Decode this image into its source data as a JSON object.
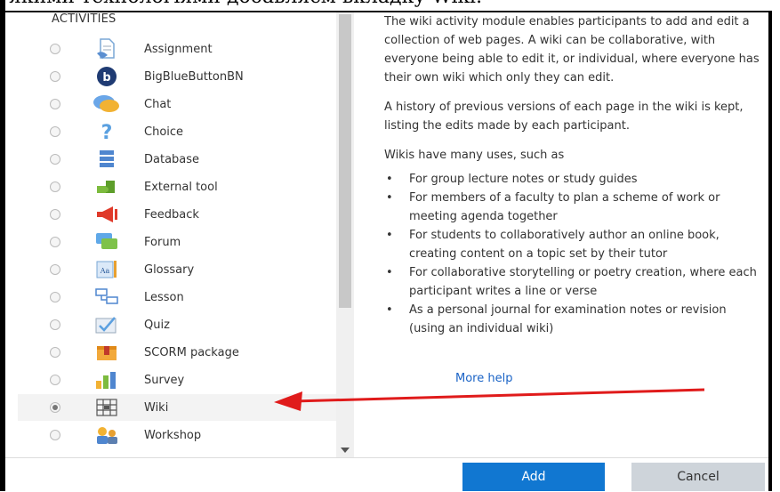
{
  "caption": "якими технологіями добавляєм вкладку Wiki:",
  "list": {
    "header": "ACTIVITIES",
    "items": [
      {
        "label": "Assignment",
        "icon": "assignment-icon",
        "selected": false
      },
      {
        "label": "BigBlueButtonBN",
        "icon": "bigbluebutton-icon",
        "selected": false
      },
      {
        "label": "Chat",
        "icon": "chat-icon",
        "selected": false
      },
      {
        "label": "Choice",
        "icon": "choice-icon",
        "selected": false
      },
      {
        "label": "Database",
        "icon": "database-icon",
        "selected": false
      },
      {
        "label": "External tool",
        "icon": "external-tool-icon",
        "selected": false
      },
      {
        "label": "Feedback",
        "icon": "feedback-icon",
        "selected": false
      },
      {
        "label": "Forum",
        "icon": "forum-icon",
        "selected": false
      },
      {
        "label": "Glossary",
        "icon": "glossary-icon",
        "selected": false
      },
      {
        "label": "Lesson",
        "icon": "lesson-icon",
        "selected": false
      },
      {
        "label": "Quiz",
        "icon": "quiz-icon",
        "selected": false
      },
      {
        "label": "SCORM package",
        "icon": "scorm-icon",
        "selected": false
      },
      {
        "label": "Survey",
        "icon": "survey-icon",
        "selected": false
      },
      {
        "label": "Wiki",
        "icon": "wiki-icon",
        "selected": true
      },
      {
        "label": "Workshop",
        "icon": "workshop-icon",
        "selected": false
      }
    ]
  },
  "help": {
    "p1": "The wiki activity module enables participants to add and edit a collection of web pages. A wiki can be collaborative, with everyone being able to edit it, or individual, where everyone has their own wiki which only they can edit.",
    "p2": "A history of previous versions of each page in the wiki is kept, listing the edits made by each participant.",
    "p3": "Wikis have many uses, such as",
    "bullets": [
      "For group lecture notes or study guides",
      "For members of a faculty to plan a scheme of work or meeting agenda together",
      "For students to collaboratively author an online book, creating content on a topic set by their tutor",
      "For collaborative storytelling or poetry creation, where each participant writes a line or verse",
      "As a personal journal for examination notes or revision (using an individual wiki)"
    ],
    "more_help": "More help"
  },
  "footer": {
    "add_label": "Add",
    "cancel_label": "Cancel"
  },
  "colors": {
    "primary": "#1177d1",
    "secondary": "#ced4da",
    "link": "#1a63c6",
    "annotation_arrow": "#e01b1b"
  }
}
